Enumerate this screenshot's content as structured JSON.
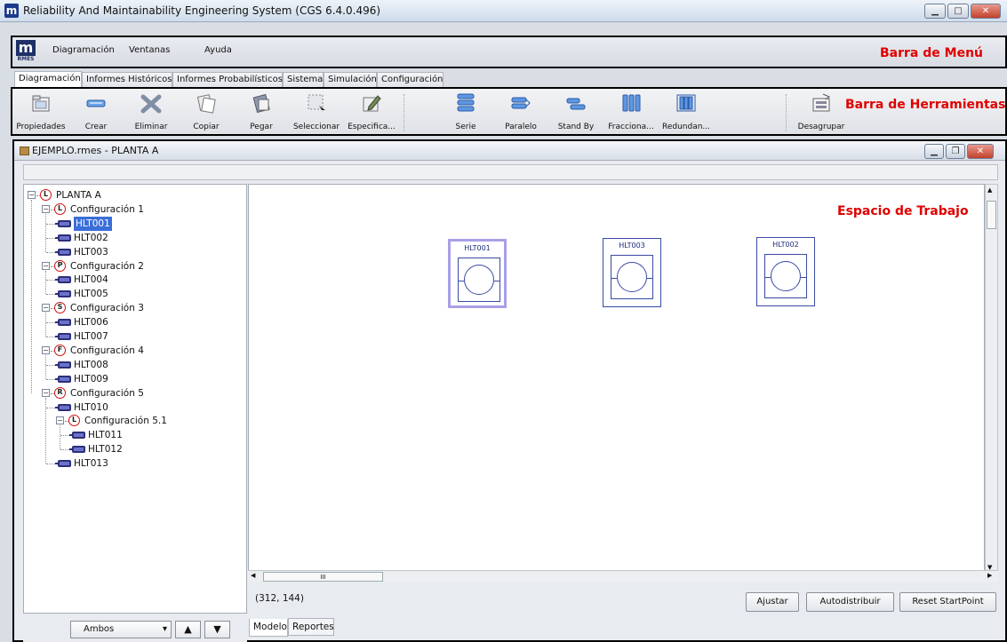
{
  "window": {
    "title": "Reliability And Maintainability Engineering System (CGS 6.4.0.496)",
    "app_logo": "m"
  },
  "menubar": {
    "logo_text": "m",
    "logo_sub": "RMES",
    "items": [
      "Diagramación",
      "Ventanas",
      "Ayuda"
    ],
    "annotation": "Barra de Menú"
  },
  "tabs": [
    "Diagramación",
    "Informes Históricos",
    "Informes Probabilísticos",
    "Sistema",
    "Simulación",
    "Configuración"
  ],
  "toolbar": {
    "annotation": "Barra de Herramientas",
    "tools": [
      {
        "label": "Propiedades",
        "icon": "folder-icon"
      },
      {
        "label": "Crear",
        "icon": "component-icon"
      },
      {
        "label": "Eliminar",
        "icon": "delete-x-icon"
      },
      {
        "label": "Copiar",
        "icon": "copy-icon"
      },
      {
        "label": "Pegar",
        "icon": "paste-icon"
      },
      {
        "label": "Seleccionar",
        "icon": "select-icon"
      },
      {
        "label": "Especifica...",
        "icon": "edit-icon"
      },
      {
        "label": "Serie",
        "icon": "series-icon"
      },
      {
        "label": "Paralelo",
        "icon": "parallel-icon"
      },
      {
        "label": "Stand By",
        "icon": "standby-icon"
      },
      {
        "label": "Fracciona...",
        "icon": "fraction-icon"
      },
      {
        "label": "Redundan...",
        "icon": "redundant-icon"
      },
      {
        "label": "Desagrupar",
        "icon": "ungroup-icon"
      }
    ]
  },
  "document": {
    "title": "EJEMPLO.rmes - PLANTA A"
  },
  "tree": [
    {
      "badge": "L",
      "label": "PLANTA A",
      "level": 0,
      "type": "group"
    },
    {
      "badge": "L",
      "label": "Configuración 1",
      "level": 1,
      "type": "group"
    },
    {
      "label": "HLT001",
      "level": 2,
      "type": "item",
      "selected": true
    },
    {
      "label": "HLT002",
      "level": 2,
      "type": "item"
    },
    {
      "label": "HLT003",
      "level": 2,
      "type": "item"
    },
    {
      "badge": "P",
      "label": "Configuración 2",
      "level": 1,
      "type": "group"
    },
    {
      "label": "HLT004",
      "level": 2,
      "type": "item"
    },
    {
      "label": "HLT005",
      "level": 2,
      "type": "item"
    },
    {
      "badge": "S",
      "label": "Configuración 3",
      "level": 1,
      "type": "group"
    },
    {
      "label": "HLT006",
      "level": 2,
      "type": "item"
    },
    {
      "label": "HLT007",
      "level": 2,
      "type": "item"
    },
    {
      "badge": "F",
      "label": "Configuración 4",
      "level": 1,
      "type": "group"
    },
    {
      "label": "HLT008",
      "level": 2,
      "type": "item"
    },
    {
      "label": "HLT009",
      "level": 2,
      "type": "item"
    },
    {
      "badge": "R",
      "label": "Configuración 5",
      "level": 1,
      "type": "group"
    },
    {
      "label": "HLT010",
      "level": 2,
      "type": "item"
    },
    {
      "badge": "L",
      "label": "Configuración 5.1",
      "level": 2,
      "type": "group"
    },
    {
      "label": "HLT011",
      "level": 3,
      "type": "item"
    },
    {
      "label": "HLT012",
      "level": 3,
      "type": "item"
    },
    {
      "label": "HLT013",
      "level": 2,
      "type": "item"
    }
  ],
  "tree_controls": {
    "filter_value": "Ambos",
    "up": "▲",
    "down": "▼"
  },
  "workspace": {
    "annotation": "Espacio de Trabajo",
    "blocks": [
      {
        "label": "HLT001",
        "selected": true
      },
      {
        "label": "HLT003",
        "selected": false
      },
      {
        "label": "HLT002",
        "selected": false
      }
    ],
    "hscroll_grip": "III"
  },
  "status": {
    "coords": "(312, 144)"
  },
  "buttons": {
    "ajustar": "Ajustar",
    "autodistribuir": "Autodistribuir",
    "reset": "Reset StartPoint"
  },
  "bottom_tabs": [
    "Modelo",
    "Reportes"
  ]
}
